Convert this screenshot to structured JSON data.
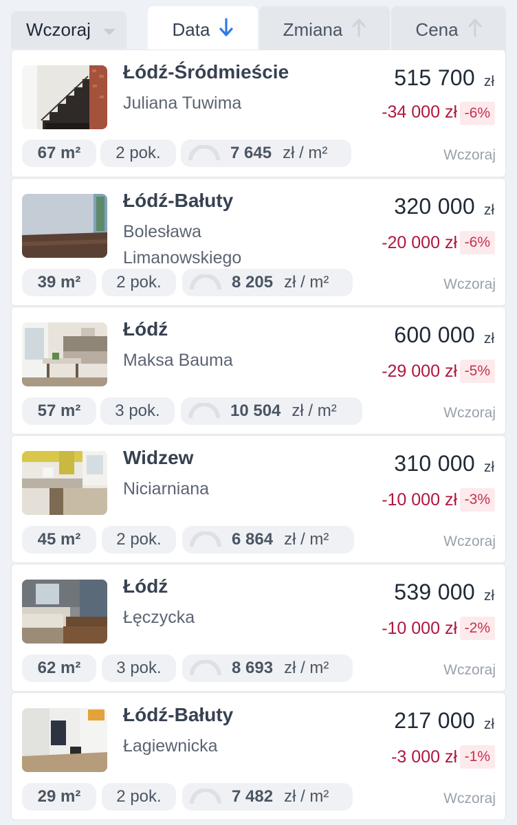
{
  "sort_bar": {
    "period_value": "Wczoraj",
    "tabs": [
      {
        "label": "Data",
        "direction": "down",
        "active": true
      },
      {
        "label": "Zmiana",
        "direction": "up",
        "active": false
      },
      {
        "label": "Cena",
        "direction": "up",
        "active": false
      }
    ]
  },
  "colors": {
    "accent_blue": "#2f7be6",
    "negative_red": "#b0163f",
    "badge_bg": "#fdeaec"
  },
  "currency": "zł",
  "listings": [
    {
      "district": "Łódź-Śródmieście",
      "street": "Juliana Tuwima",
      "price": "515 700",
      "change": "-34 000 zł",
      "change_pct": "-6%",
      "area": "67 m²",
      "rooms": "2 pok.",
      "price_per_m2": "7 645",
      "ppm_unit": "zł / m²",
      "date": "Wczoraj",
      "photo": "stairs-photo"
    },
    {
      "district": "Łódź-Bałuty",
      "street": "Bolesława Limanowskiego",
      "price": "320 000",
      "change": "-20 000 zł",
      "change_pct": "-6%",
      "area": "39 m²",
      "rooms": "2 pok.",
      "price_per_m2": "8 205",
      "ppm_unit": "zł / m²",
      "date": "Wczoraj",
      "photo": "empty-room-photo"
    },
    {
      "district": "Łódź",
      "street": "Maksa Bauma",
      "price": "600 000",
      "change": "-29 000 zł",
      "change_pct": "-5%",
      "area": "57 m²",
      "rooms": "3 pok.",
      "price_per_m2": "10 504",
      "ppm_unit": "zł / m²",
      "date": "Wczoraj",
      "photo": "kitchen-dining-photo"
    },
    {
      "district": "Widzew",
      "street": "Niciarniana",
      "price": "310 000",
      "change": "-10 000 zł",
      "change_pct": "-3%",
      "area": "45 m²",
      "rooms": "2 pok.",
      "price_per_m2": "6 864",
      "ppm_unit": "zł / m²",
      "date": "Wczoraj",
      "photo": "kitchen-photo"
    },
    {
      "district": "Łódź",
      "street": "Łęczycka",
      "price": "539 000",
      "change": "-10 000 zł",
      "change_pct": "-2%",
      "area": "62 m²",
      "rooms": "3 pok.",
      "price_per_m2": "8 693",
      "ppm_unit": "zł / m²",
      "date": "Wczoraj",
      "photo": "living-room-photo"
    },
    {
      "district": "Łódź-Bałuty",
      "street": "Łagiewnicka",
      "price": "217 000",
      "change": "-3 000 zł",
      "change_pct": "-1%",
      "area": "29 m²",
      "rooms": "2 pok.",
      "price_per_m2": "7 482",
      "ppm_unit": "zł / m²",
      "date": "Wczoraj",
      "photo": "studio-photo"
    }
  ]
}
